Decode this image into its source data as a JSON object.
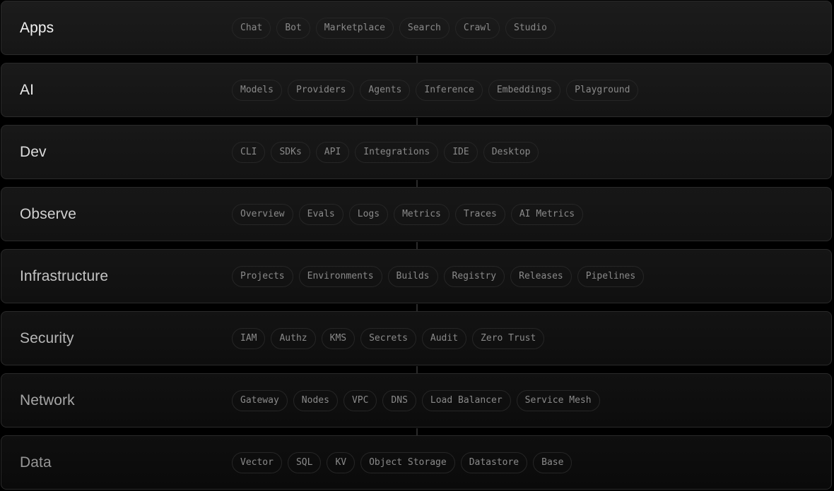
{
  "rows": [
    {
      "title": "Apps",
      "items": [
        "Chat",
        "Bot",
        "Marketplace",
        "Search",
        "Crawl",
        "Studio"
      ]
    },
    {
      "title": "AI",
      "items": [
        "Models",
        "Providers",
        "Agents",
        "Inference",
        "Embeddings",
        "Playground"
      ]
    },
    {
      "title": "Dev",
      "items": [
        "CLI",
        "SDKs",
        "API",
        "Integrations",
        "IDE",
        "Desktop"
      ]
    },
    {
      "title": "Observe",
      "items": [
        "Overview",
        "Evals",
        "Logs",
        "Metrics",
        "Traces",
        "AI Metrics"
      ]
    },
    {
      "title": "Infrastructure",
      "items": [
        "Projects",
        "Environments",
        "Builds",
        "Registry",
        "Releases",
        "Pipelines"
      ]
    },
    {
      "title": "Security",
      "items": [
        "IAM",
        "Authz",
        "KMS",
        "Secrets",
        "Audit",
        "Zero Trust"
      ]
    },
    {
      "title": "Network",
      "items": [
        "Gateway",
        "Nodes",
        "VPC",
        "DNS",
        "Load Balancer",
        "Service Mesh"
      ]
    },
    {
      "title": "Data",
      "items": [
        "Vector",
        "SQL",
        "KV",
        "Object Storage",
        "Datastore",
        "Base"
      ]
    }
  ]
}
